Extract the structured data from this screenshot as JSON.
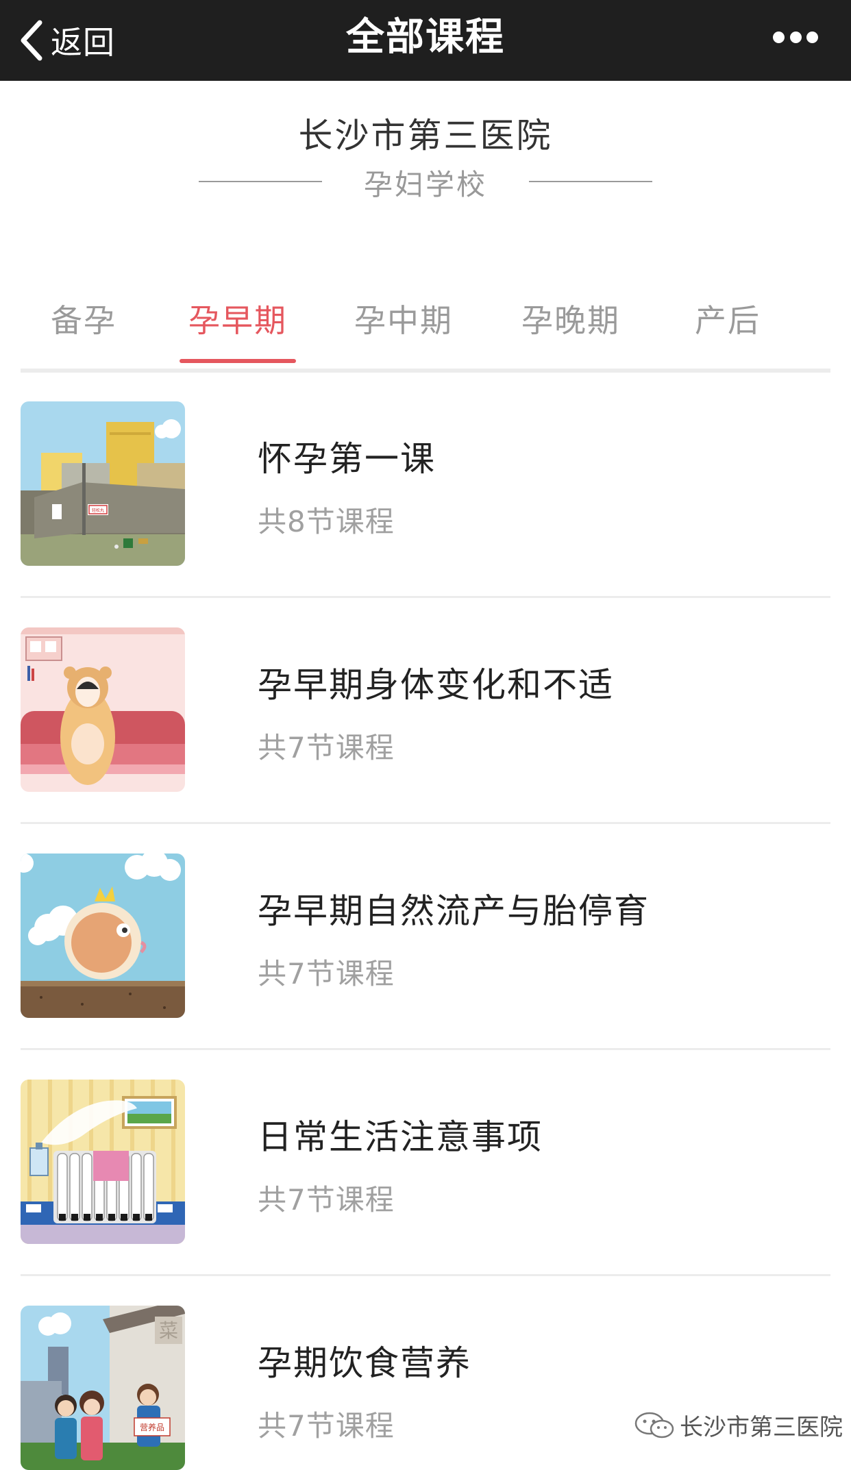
{
  "nav": {
    "back_label": "返回",
    "title": "全部课程",
    "more_icon": "more-icon"
  },
  "header": {
    "hospital": "长沙市第三医院",
    "school": "孕妇学校"
  },
  "tabs": [
    {
      "label": "备孕",
      "active": false
    },
    {
      "label": "孕早期",
      "active": true
    },
    {
      "label": "孕中期",
      "active": false
    },
    {
      "label": "孕晚期",
      "active": false
    },
    {
      "label": "产后",
      "active": false
    }
  ],
  "courses": [
    {
      "title": "怀孕第一课",
      "count": "共8节课程",
      "thumb_sign": "轻松丸"
    },
    {
      "title": "孕早期身体变化和不适",
      "count": "共7节课程"
    },
    {
      "title": "孕早期自然流产与胎停育",
      "count": "共7节课程"
    },
    {
      "title": "日常生活注意事项",
      "count": "共7节课程"
    },
    {
      "title": "孕期饮食营养",
      "count": "共7节课程",
      "thumb_sign": "营养品",
      "thumb_wall": "菜"
    }
  ],
  "watermark": {
    "text": "长沙市第三医院"
  },
  "colors": {
    "accent": "#e5575e",
    "navbar": "#1f1f1f",
    "muted": "#9a9a9a"
  }
}
